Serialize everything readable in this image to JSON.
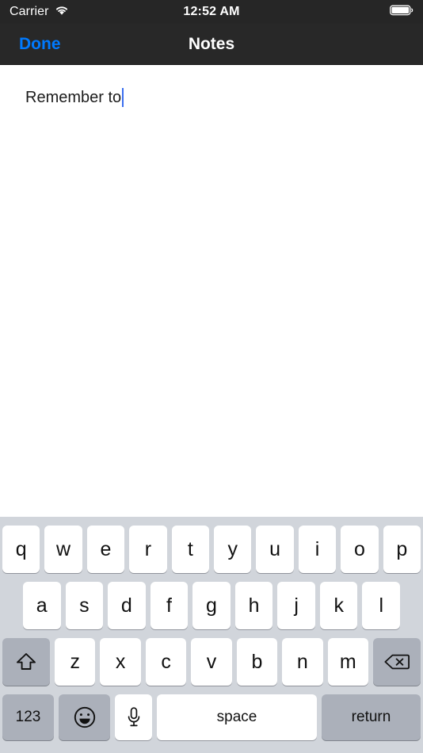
{
  "status_bar": {
    "carrier": "Carrier",
    "wifi_icon": "wifi-icon",
    "time": "12:52 AM",
    "battery_icon": "battery-full-icon"
  },
  "nav_bar": {
    "done_label": "Done",
    "title": "Notes"
  },
  "note": {
    "text": "Remember to",
    "caret_visible": true
  },
  "keyboard": {
    "row1": [
      "q",
      "w",
      "e",
      "r",
      "t",
      "y",
      "u",
      "i",
      "o",
      "p"
    ],
    "row2": [
      "a",
      "s",
      "d",
      "f",
      "g",
      "h",
      "j",
      "k",
      "l"
    ],
    "row3": [
      "z",
      "x",
      "c",
      "v",
      "b",
      "n",
      "m"
    ],
    "shift_icon": "shift-arrow-icon",
    "backspace_icon": "backspace-delete-icon",
    "numbers_label": "123",
    "emoji_icon": "emoji-smiley-icon",
    "mic_icon": "microphone-icon",
    "space_label": "space",
    "return_label": "return"
  },
  "colors": {
    "accent_blue": "#007AFF",
    "caret_blue": "#3B6FEF",
    "status_bar_bg": "#262626",
    "nav_bar_bg": "#282828",
    "keyboard_bg": "#D1D5DB",
    "key_bg": "#FFFFFF",
    "key_dark_bg": "#ABB0BA"
  }
}
